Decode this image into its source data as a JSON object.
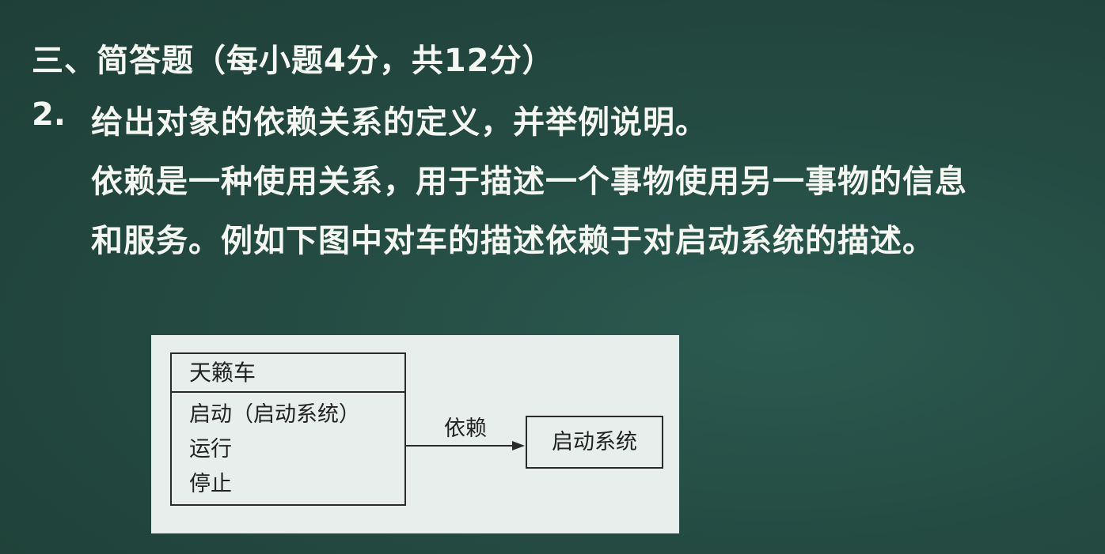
{
  "section": {
    "heading": "三、简答题（每小题4分，共12分）"
  },
  "question": {
    "number": "2.",
    "text": "给出对象的依赖关系的定义，并举例说明。"
  },
  "answer": {
    "line1": "依赖是一种使用关系，用于描述一个事物使用另一事物的信息",
    "line2": "和服务。例如下图中对车的描述依赖于对启动系统的描述。"
  },
  "diagram": {
    "class_name": "天籁车",
    "operations": [
      "启动（启动系统）",
      "运行",
      "停止"
    ],
    "relation_label": "依赖",
    "target_name": "启动系统"
  }
}
